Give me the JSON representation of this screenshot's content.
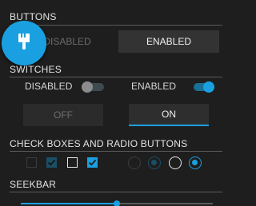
{
  "sections": {
    "buttons": "BUTTONS",
    "switches": "SWITCHES",
    "checks": "CHECK BOXES AND RADIO BUTTONS",
    "seekbar": "SEEKBAR"
  },
  "buttons": {
    "disabled_label": "DISABLED",
    "enabled_label": "ENABLED"
  },
  "fab": {
    "icon": "paint-brush-icon",
    "color": "#1aa0e0"
  },
  "switches": {
    "disabled_label": "DISABLED",
    "enabled_label": "ENABLED",
    "disabled_on": false,
    "enabled_on": true
  },
  "toggles": {
    "off_label": "OFF",
    "on_label": "ON",
    "selected": "ON"
  },
  "checkboxes": [
    {
      "state": "unchecked",
      "enabled": false
    },
    {
      "state": "checked",
      "enabled": false
    },
    {
      "state": "unchecked",
      "enabled": true
    },
    {
      "state": "checked",
      "enabled": true
    }
  ],
  "radios": [
    {
      "state": "unselected",
      "enabled": false
    },
    {
      "state": "selected",
      "enabled": false
    },
    {
      "state": "unselected",
      "enabled": true
    },
    {
      "state": "selected",
      "enabled": true
    }
  ],
  "seekbar": {
    "value_fraction": 0.5
  },
  "colors": {
    "accent": "#1aa0e0",
    "background": "#1e1e1e"
  }
}
